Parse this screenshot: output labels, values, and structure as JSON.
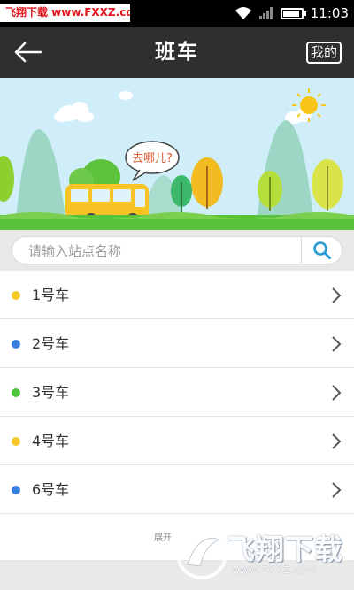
{
  "status_bar": {
    "watermark": "飞翔下载 www.FXXZ.com",
    "time": "11:03",
    "battery_level": 0.9
  },
  "header": {
    "title": "班车",
    "mine_label": "我的"
  },
  "banner": {
    "bubble_text": "去哪儿?"
  },
  "search": {
    "placeholder": "请输入站点名称"
  },
  "bus_list": [
    {
      "label": "1号车",
      "color": "#f5c92a"
    },
    {
      "label": "2号车",
      "color": "#3a7fe0"
    },
    {
      "label": "3号车",
      "color": "#4ec43c"
    },
    {
      "label": "4号车",
      "color": "#f5c92a"
    },
    {
      "label": "6号车",
      "color": "#3a7fe0"
    }
  ],
  "footer": {
    "expand_text": "展开"
  },
  "logo_watermark": {
    "title": "飞翔下载",
    "url": "www.FXXZ.com"
  }
}
